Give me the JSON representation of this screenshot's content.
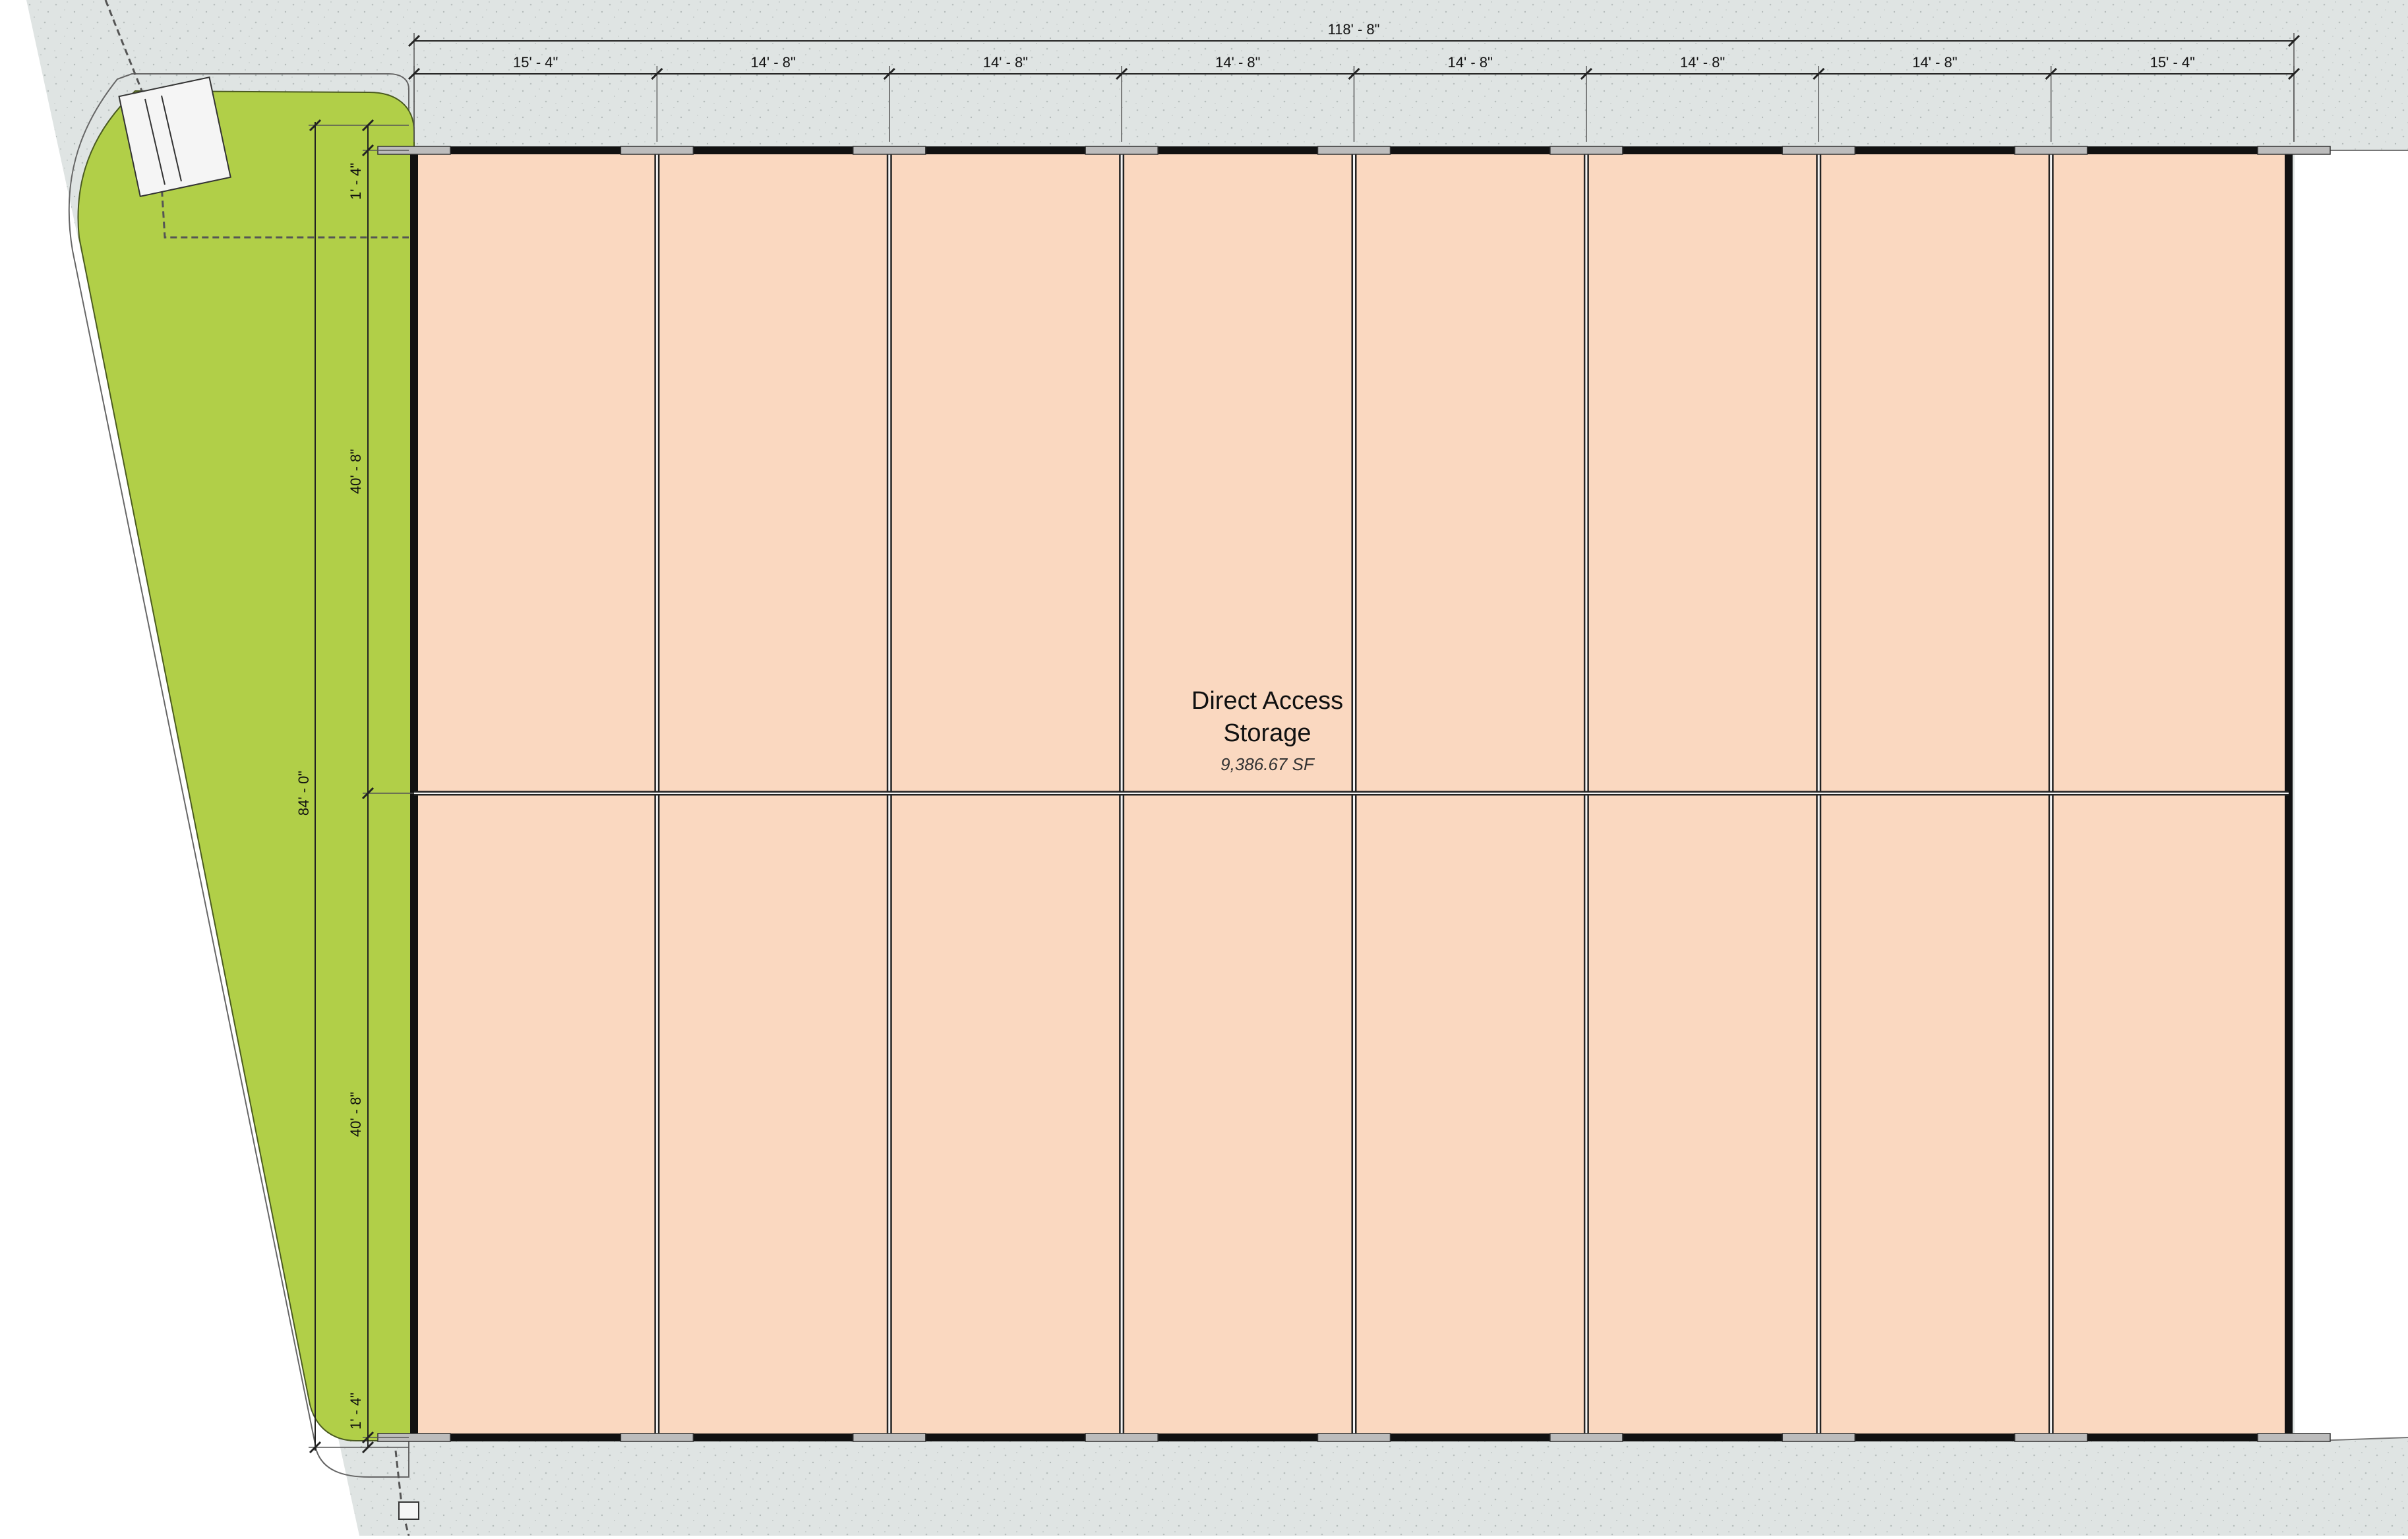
{
  "colors": {
    "paving": "#dfe4e3",
    "landscape": "#b1cf48",
    "storage": "#fad8c0",
    "wall": "#111111",
    "background": "#ffffff"
  },
  "room": {
    "name_line1": "Direct Access",
    "name_line2": "Storage",
    "area": "9,386.67 SF"
  },
  "dimensions": {
    "overall_width": "118' - 8\"",
    "bays": [
      "15' - 4\"",
      "14' - 8\"",
      "14' - 8\"",
      "14' - 8\"",
      "14' - 8\"",
      "14' - 8\"",
      "14' - 8\"",
      "15' - 4\""
    ],
    "overall_depth": "84' - 0\"",
    "upper_half": "40' - 8\"",
    "lower_half": "40' - 8\"",
    "top_offset": "1' - 4\"",
    "bottom_offset": "1' - 4\""
  },
  "icons": {
    "transformer": "utility-equipment-icon",
    "gate": "gate-icon"
  }
}
